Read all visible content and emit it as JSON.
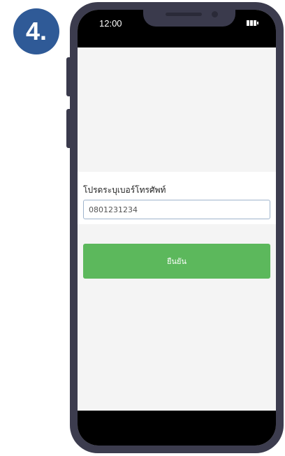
{
  "step_badge": "4.",
  "status_bar": {
    "time": "12:00",
    "battery_icon": "battery-icon"
  },
  "form": {
    "label": "โปรดระบุเบอร์โทรศัพท์",
    "phone_value": "0801231234",
    "confirm_label": "ยืนยัน"
  },
  "colors": {
    "badge": "#2f5a97",
    "phone_frame": "#3c3c4e",
    "confirm_button": "#5cb85c",
    "input_border": "#9fb4cc"
  }
}
